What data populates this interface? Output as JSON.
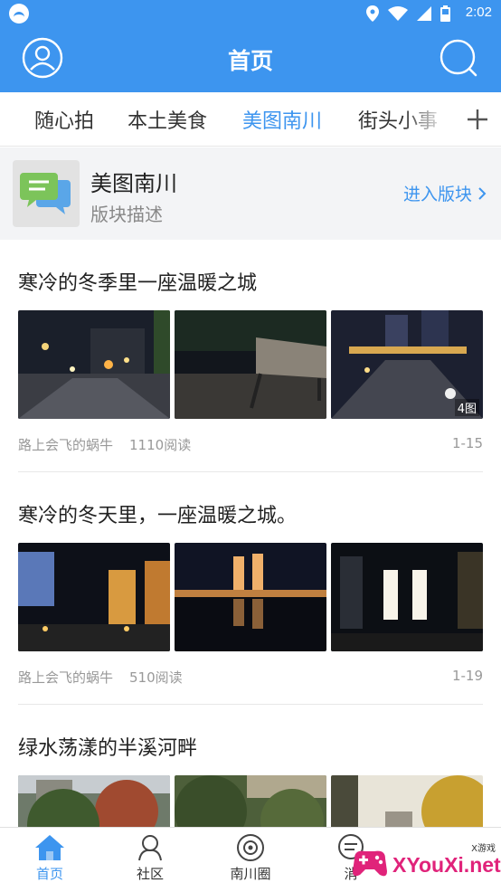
{
  "status_bar": {
    "time": "2:02"
  },
  "header": {
    "title": "首页"
  },
  "tabs": [
    {
      "label": "随心拍",
      "active": false
    },
    {
      "label": "本土美食",
      "active": false
    },
    {
      "label": "美图南川",
      "active": true
    },
    {
      "label": "街头小事",
      "active": false
    }
  ],
  "section": {
    "name": "美图南川",
    "description": "版块描述",
    "enter_label": "进入版块"
  },
  "posts": [
    {
      "title": "寒冷的冬季里一座温暖之城",
      "author": "路上会飞的蜗牛",
      "reads": "1110阅读",
      "date": "1-15",
      "image_count": "4图"
    },
    {
      "title": "寒冷的冬天里，一座温暖之城。",
      "author": "路上会飞的蜗牛",
      "reads": "510阅读",
      "date": "1-19"
    },
    {
      "title": "绿水荡漾的半溪河畔"
    }
  ],
  "bottom_nav": [
    {
      "label": "首页",
      "icon": "home-icon",
      "active": true
    },
    {
      "label": "社区",
      "icon": "community-icon",
      "active": false
    },
    {
      "label": "南川圈",
      "icon": "circle-icon",
      "active": false
    },
    {
      "label": "消",
      "icon": "message-icon",
      "active": false
    }
  ],
  "watermark": {
    "text": "XYouXi.net",
    "small": "X游戏"
  },
  "colors": {
    "primary": "#3d95ef",
    "background": "#ffffff",
    "section_bg": "#f3f4f6"
  }
}
